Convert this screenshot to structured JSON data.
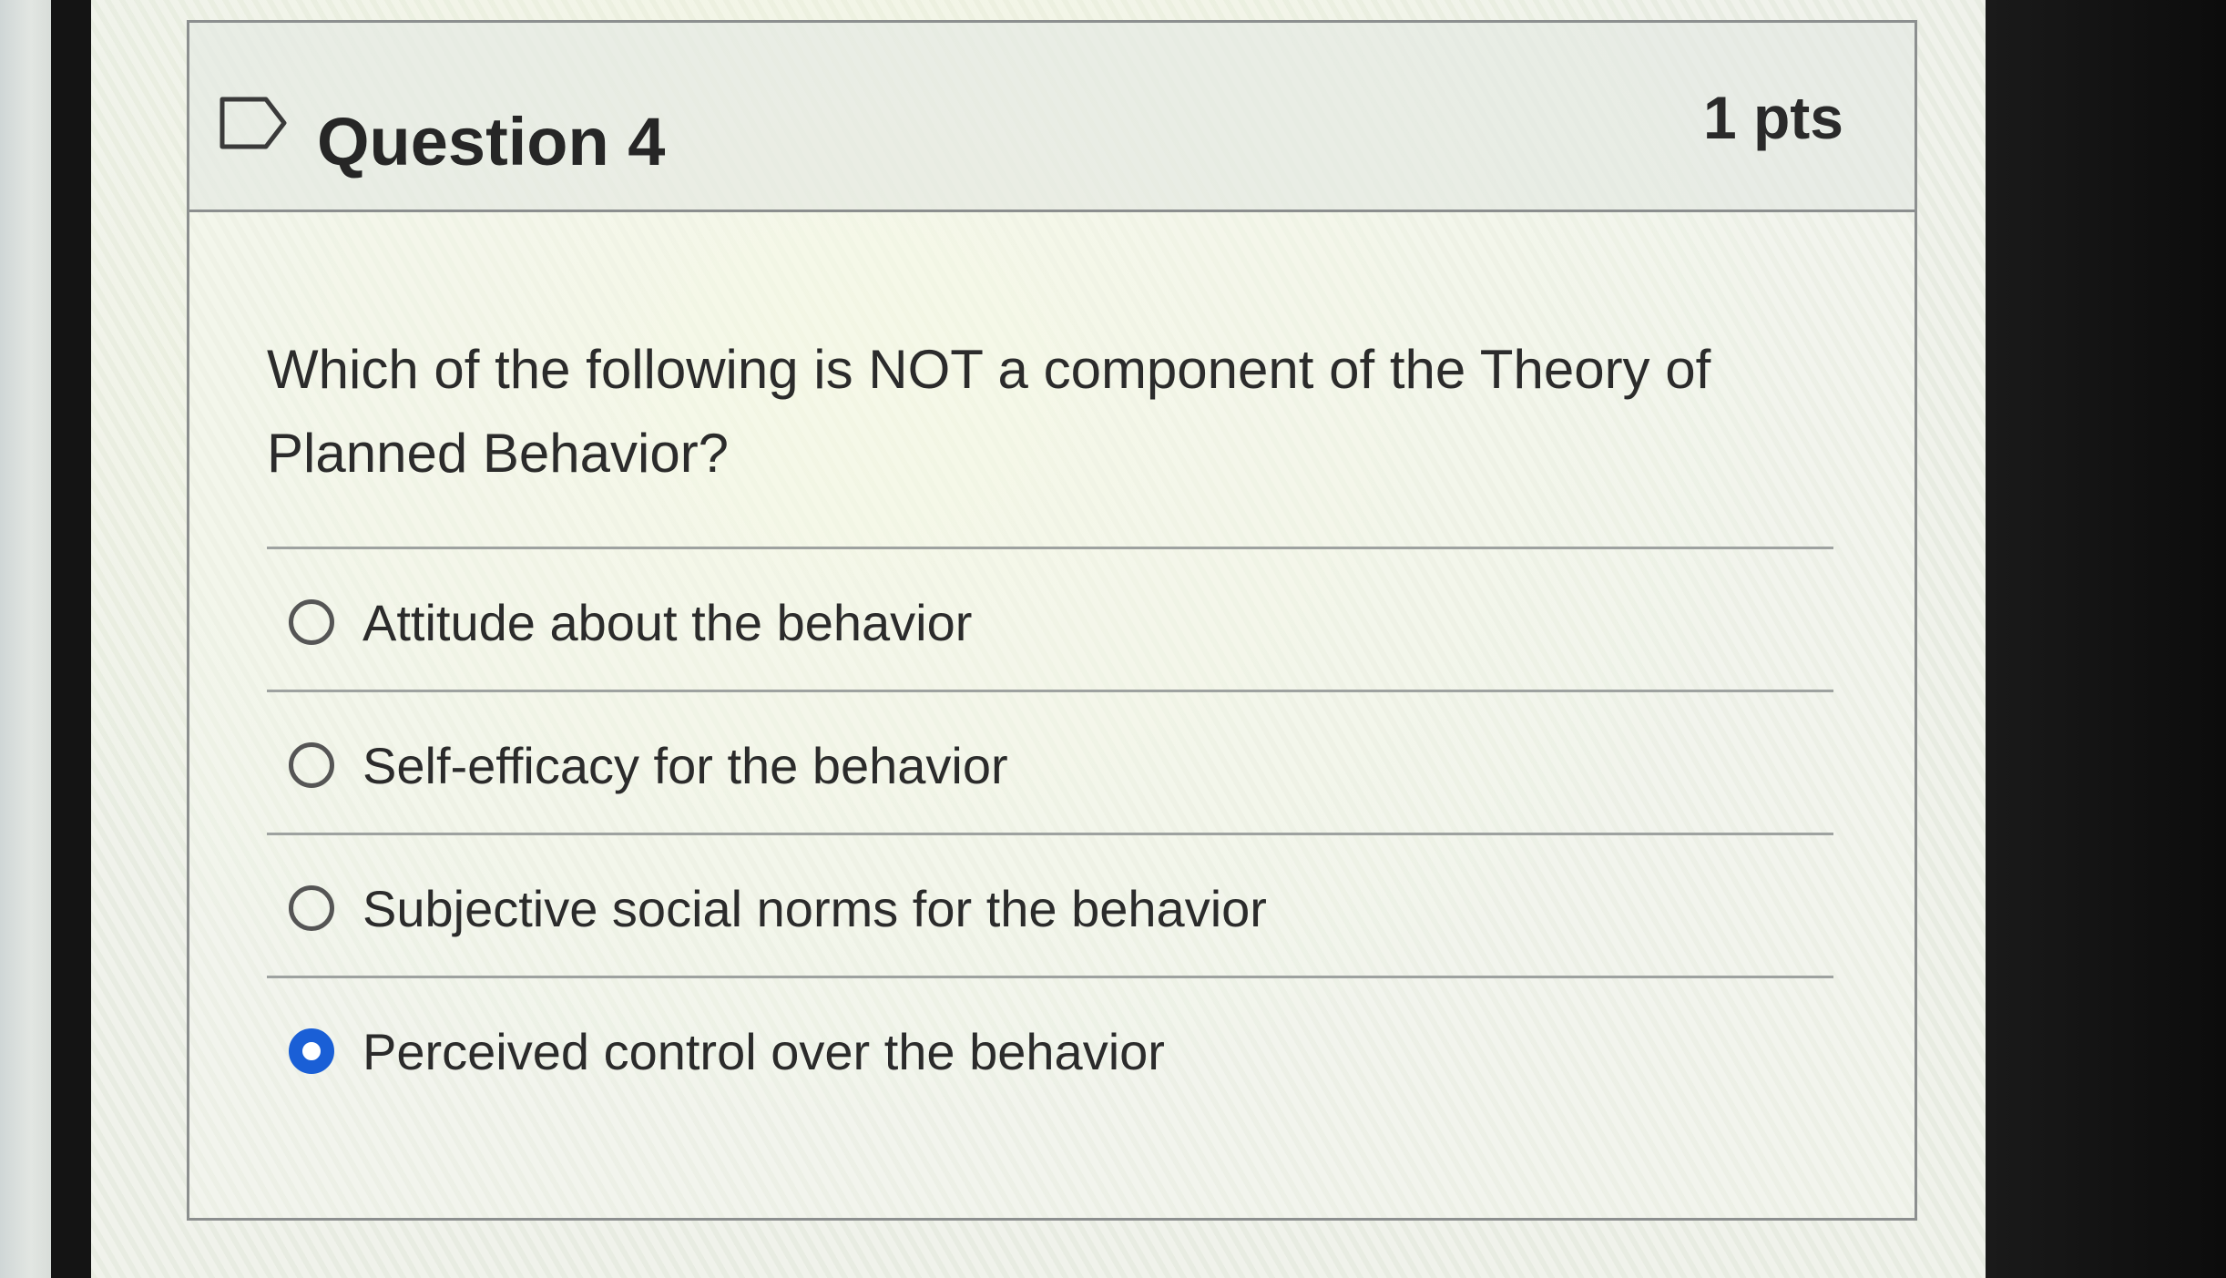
{
  "question": {
    "title": "Question 4",
    "points": "1 pts",
    "flag_icon": "bookmark-flag-icon",
    "text": "Which of the following is NOT a component of the Theory of Planned Behavior?"
  },
  "answers": [
    {
      "label": "Attitude about the behavior",
      "selected": false
    },
    {
      "label": "Self-efficacy for the behavior",
      "selected": false
    },
    {
      "label": "Subjective social norms for the behavior",
      "selected": false
    },
    {
      "label": "Perceived control over the behavior",
      "selected": true
    }
  ],
  "colors": {
    "selected_radio": "#1a5fd6",
    "border": "#8c8f8f",
    "text": "#2b2b2b"
  }
}
